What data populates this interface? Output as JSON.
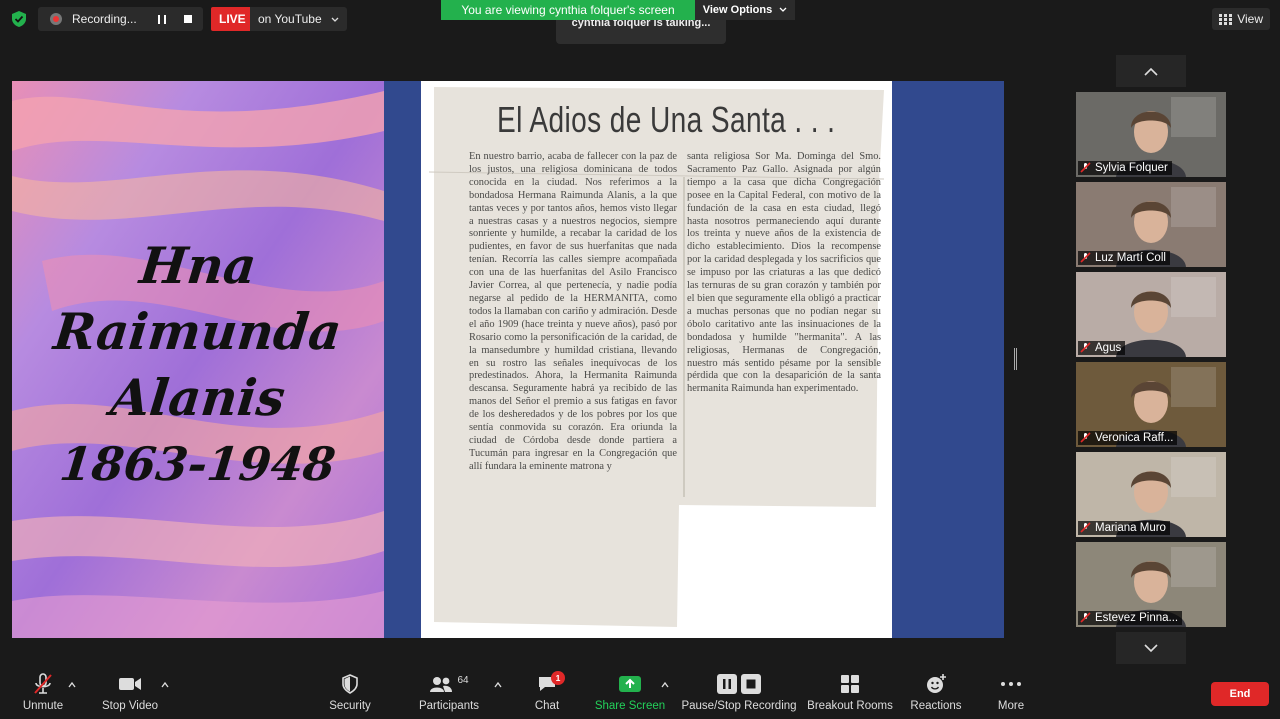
{
  "topbar": {
    "recording_label": "Recording...",
    "live_label": "LIVE",
    "youtube_label": "on YouTube",
    "viewing_banner": "You are viewing cynthia folquer's screen",
    "view_options": "View Options",
    "talking": "cynthia folquer is talking...",
    "view_label": "View"
  },
  "slide": {
    "name_lines": [
      "Hna",
      "Raimunda",
      "Alanis"
    ],
    "years": "1863-1948",
    "clipping_title": "El Adios de Una Santa . . .",
    "col1": "En nuestro barrio, acaba de fallecer con la paz de los justos, una religiosa dominicana de todos conocida en la ciudad. Nos referimos a la bondadosa Hermana Raimunda Alanis, a la que tantas veces y por tantos años, hemos visto llegar a nuestras casas y a nuestros negocios, siempre sonriente y humilde, a recabar la caridad de los pudientes, en favor de sus huerfanitas que nada tenían. Recorría las calles siempre acompañada con una de las huerfanitas del Asilo Francisco Javier Correa, al que pertenecía, y nadie podía negarse al pedido de la HERMANITA, como todos la llamaban con cariño y admiración. Desde el año 1909 (hace treinta y nueve años), pasó por Rosario como la personificación de la caridad, de la mansedumbre y humildad cristiana, llevando en su rostro las señales inequívocas de los predestinados. Ahora, la Hermanita Raimunda descansa. Seguramente habrá ya recibido de las manos del Señor el premio a sus fatigas en favor de los desheredados y de los pobres por los que sentía conmovida su corazón. Era oriunda la ciudad de Córdoba desde donde partiera a Tucumán para ingresar en la Congregación que allí fundara la eminente matrona y",
    "col2": "santa religiosa Sor Ma. Dominga del Smo. Sacramento Paz Gallo. Asignada por algún tiempo a la casa que dicha Congregación posee en la Capital Federal, con motivo de la fundación de la casa en esta ciudad, llegó hasta nosotros permaneciendo aquí durante los treinta y nueve años de la existencia de dicho establecimiento. Dios la recompense por la caridad desplegada y los sacrificios que se impuso por las criaturas a las que dedicó las ternuras de su gran corazón y también por el bien que seguramente ella obligó a practicar a muchas personas que no podían negar su óbolo caritativo ante las insinuaciones de la bondadosa y humilde \"hermanita\". A las religiosas, Hermanas de Congregación, nuestro más sentido pésame por la sensible pérdida que con la desaparición de la santa hermanita Raimunda han experimentado."
  },
  "participants": [
    {
      "name": "Sylvia Folquer",
      "bg": "#6b6a66"
    },
    {
      "name": "Luz Martí Coll",
      "bg": "#8a7b72"
    },
    {
      "name": "Agus",
      "bg": "#b9aca6"
    },
    {
      "name": "Veronica Raff...",
      "bg": "#6e5a3c"
    },
    {
      "name": "Mariana Muro",
      "bg": "#bfb6a8"
    },
    {
      "name": "Estevez Pinna...",
      "bg": "#8d8779"
    }
  ],
  "toolbar": {
    "unmute": "Unmute",
    "stop_video": "Stop Video",
    "security": "Security",
    "participants": "Participants",
    "participants_count": "64",
    "chat": "Chat",
    "chat_badge": "1",
    "share_screen": "Share Screen",
    "pause_recording": "Pause/Stop Recording",
    "breakout": "Breakout Rooms",
    "reactions": "Reactions",
    "more": "More",
    "end": "End"
  },
  "colors": {
    "accent_green": "#23b14d",
    "live_red": "#e02828",
    "slide_blue": "#31498e"
  }
}
